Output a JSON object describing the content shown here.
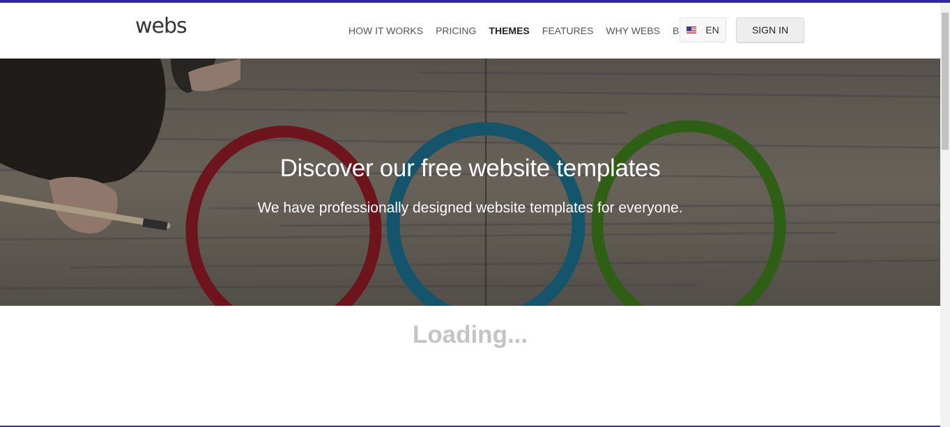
{
  "header": {
    "logo": "webs",
    "nav": [
      {
        "label": "HOW IT WORKS",
        "active": false
      },
      {
        "label": "PRICING",
        "active": false
      },
      {
        "label": "THEMES",
        "active": true
      },
      {
        "label": "FEATURES",
        "active": false
      },
      {
        "label": "WHY WEBS",
        "active": false
      },
      {
        "label": "BLOG",
        "active": false
      }
    ],
    "language": {
      "label": "EN",
      "icon": "us-flag-icon"
    },
    "signin_label": "SIGN IN"
  },
  "hero": {
    "title": "Discover our free website templates",
    "subtitle": "We have professionally designed website templates for everyone."
  },
  "main": {
    "loading_text": "Loading..."
  },
  "colors": {
    "accent": "#2e2a9e",
    "ring_red": "#8c1a24",
    "ring_blue": "#1a6d8a",
    "ring_green": "#3d7a1c"
  }
}
